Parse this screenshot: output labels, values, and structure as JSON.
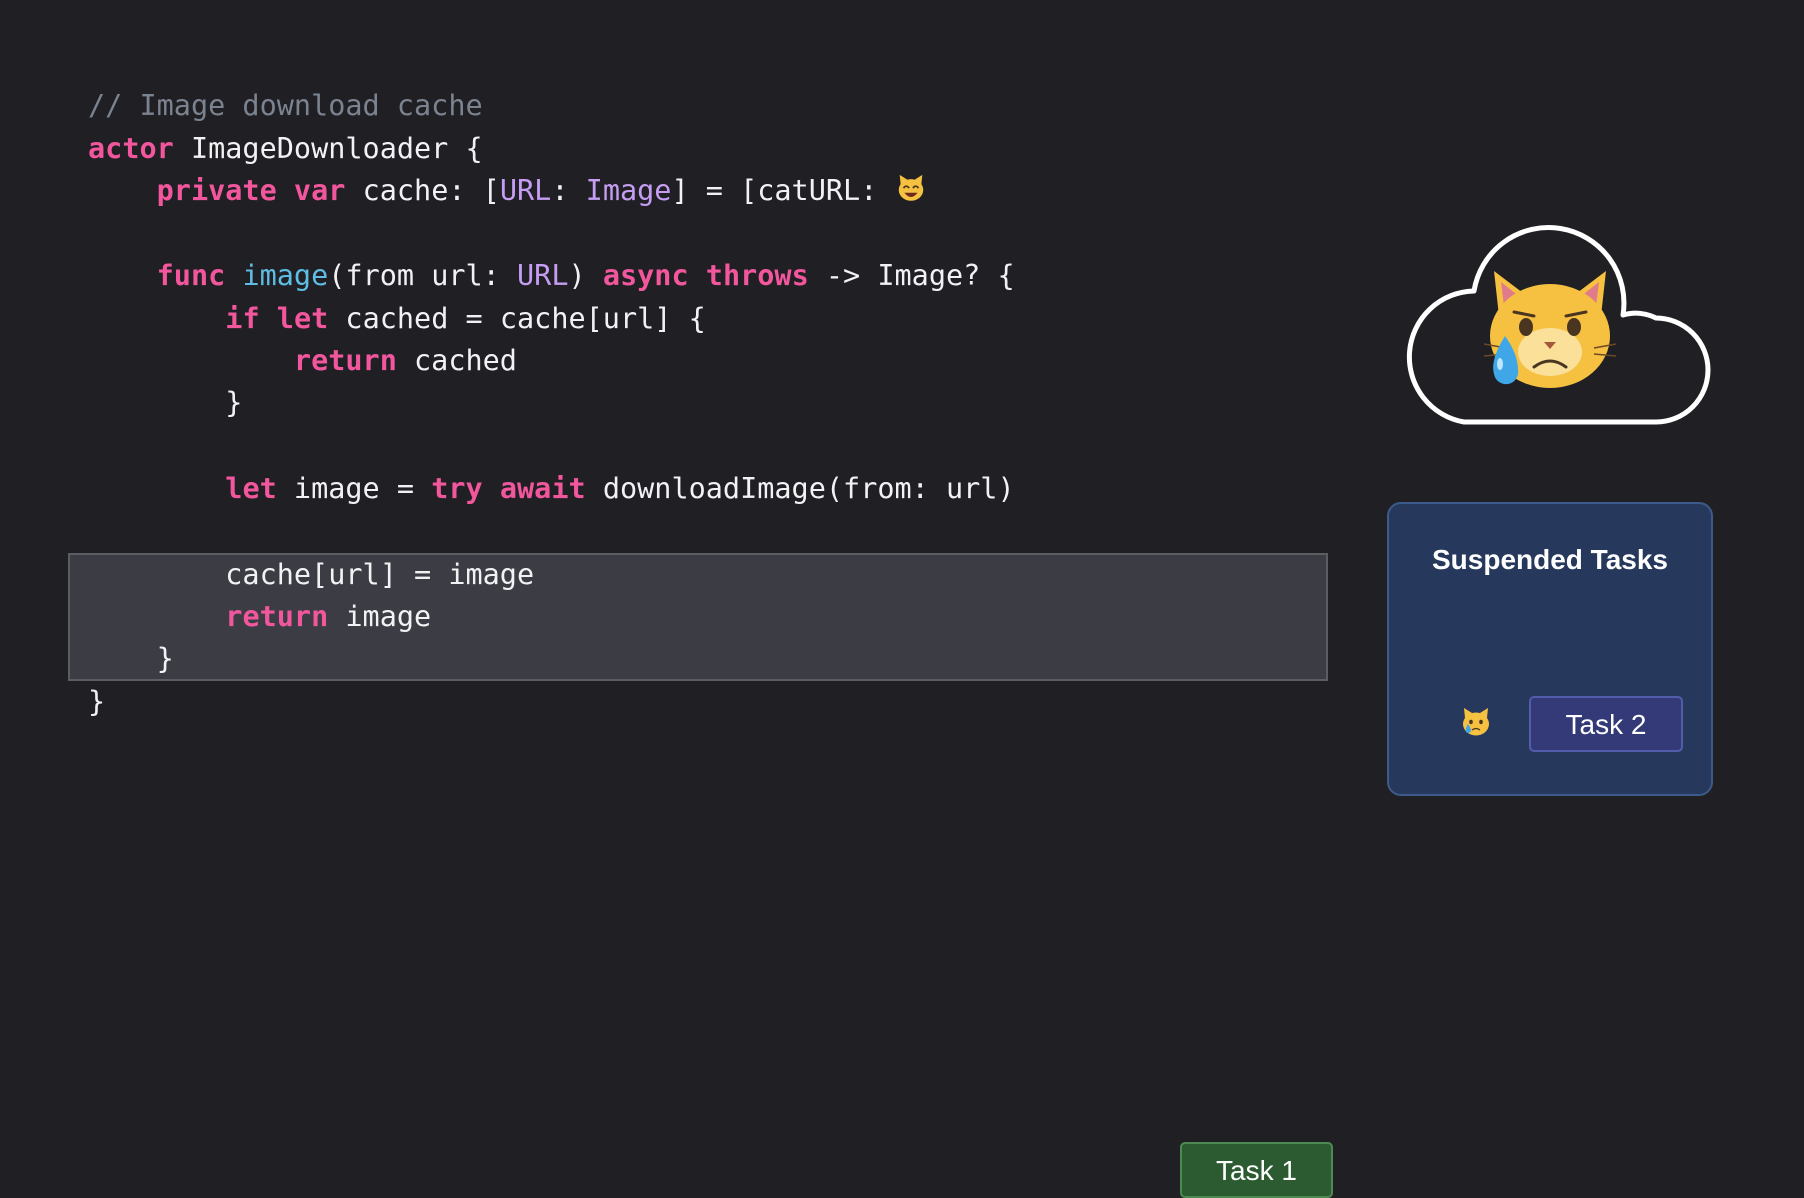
{
  "code": {
    "lines": [
      [
        {
          "t": "// Image download cache",
          "c": "comment"
        }
      ],
      [
        {
          "t": "actor",
          "c": "keyword"
        },
        {
          "t": " ImageDownloader {",
          "c": "plain"
        }
      ],
      [
        {
          "t": "    ",
          "c": "plain"
        },
        {
          "t": "private",
          "c": "keyword"
        },
        {
          "t": " ",
          "c": "plain"
        },
        {
          "t": "var",
          "c": "keyword"
        },
        {
          "t": " cache: [",
          "c": "plain"
        },
        {
          "t": "URL",
          "c": "type"
        },
        {
          "t": ": ",
          "c": "plain"
        },
        {
          "t": "Image",
          "c": "type"
        },
        {
          "t": "] = [catURL: ",
          "c": "plain"
        }
      ],
      [],
      [
        {
          "t": "    ",
          "c": "plain"
        },
        {
          "t": "func",
          "c": "keyword"
        },
        {
          "t": " ",
          "c": "plain"
        },
        {
          "t": "image",
          "c": "func"
        },
        {
          "t": "(from url: ",
          "c": "plain"
        },
        {
          "t": "URL",
          "c": "type"
        },
        {
          "t": ") ",
          "c": "plain"
        },
        {
          "t": "async",
          "c": "keyword"
        },
        {
          "t": " ",
          "c": "plain"
        },
        {
          "t": "throws",
          "c": "keyword"
        },
        {
          "t": " -> Image? {",
          "c": "plain"
        }
      ],
      [
        {
          "t": "        ",
          "c": "plain"
        },
        {
          "t": "if",
          "c": "keyword"
        },
        {
          "t": " ",
          "c": "plain"
        },
        {
          "t": "let",
          "c": "keyword"
        },
        {
          "t": " cached = cache[url] {",
          "c": "plain"
        }
      ],
      [
        {
          "t": "            ",
          "c": "plain"
        },
        {
          "t": "return",
          "c": "keyword"
        },
        {
          "t": " cached",
          "c": "plain"
        }
      ],
      [
        {
          "t": "        }",
          "c": "plain"
        }
      ],
      [],
      [
        {
          "t": "        ",
          "c": "plain"
        },
        {
          "t": "let",
          "c": "keyword"
        },
        {
          "t": " image = ",
          "c": "plain"
        },
        {
          "t": "try",
          "c": "keyword"
        },
        {
          "t": " ",
          "c": "plain"
        },
        {
          "t": "await",
          "c": "keyword"
        },
        {
          "t": " downloadImage(from: url)",
          "c": "plain"
        }
      ],
      [],
      [
        {
          "t": "        cache[url] = image",
          "c": "plain"
        }
      ],
      [
        {
          "t": "        ",
          "c": "plain"
        },
        {
          "t": "return",
          "c": "keyword"
        },
        {
          "t": " image",
          "c": "plain"
        }
      ],
      [
        {
          "t": "    }",
          "c": "plain"
        }
      ],
      [
        {
          "t": "}",
          "c": "plain"
        }
      ]
    ]
  },
  "cache_emoji": "grinning-cat-icon",
  "cloud": {
    "icon": "crying-cat-icon"
  },
  "task1": {
    "label": "Task 1"
  },
  "suspended": {
    "title": "Suspended Tasks",
    "cat_icon": "crying-cat-icon",
    "task2_label": "Task 2"
  },
  "colors": {
    "background": "#1f1f24",
    "keyword": "#f2569c",
    "type": "#c59df2",
    "function": "#5fbde3",
    "comment": "#7c8390",
    "task1": "#2c5b31",
    "task2": "#343a78",
    "panel": "#26385b"
  }
}
